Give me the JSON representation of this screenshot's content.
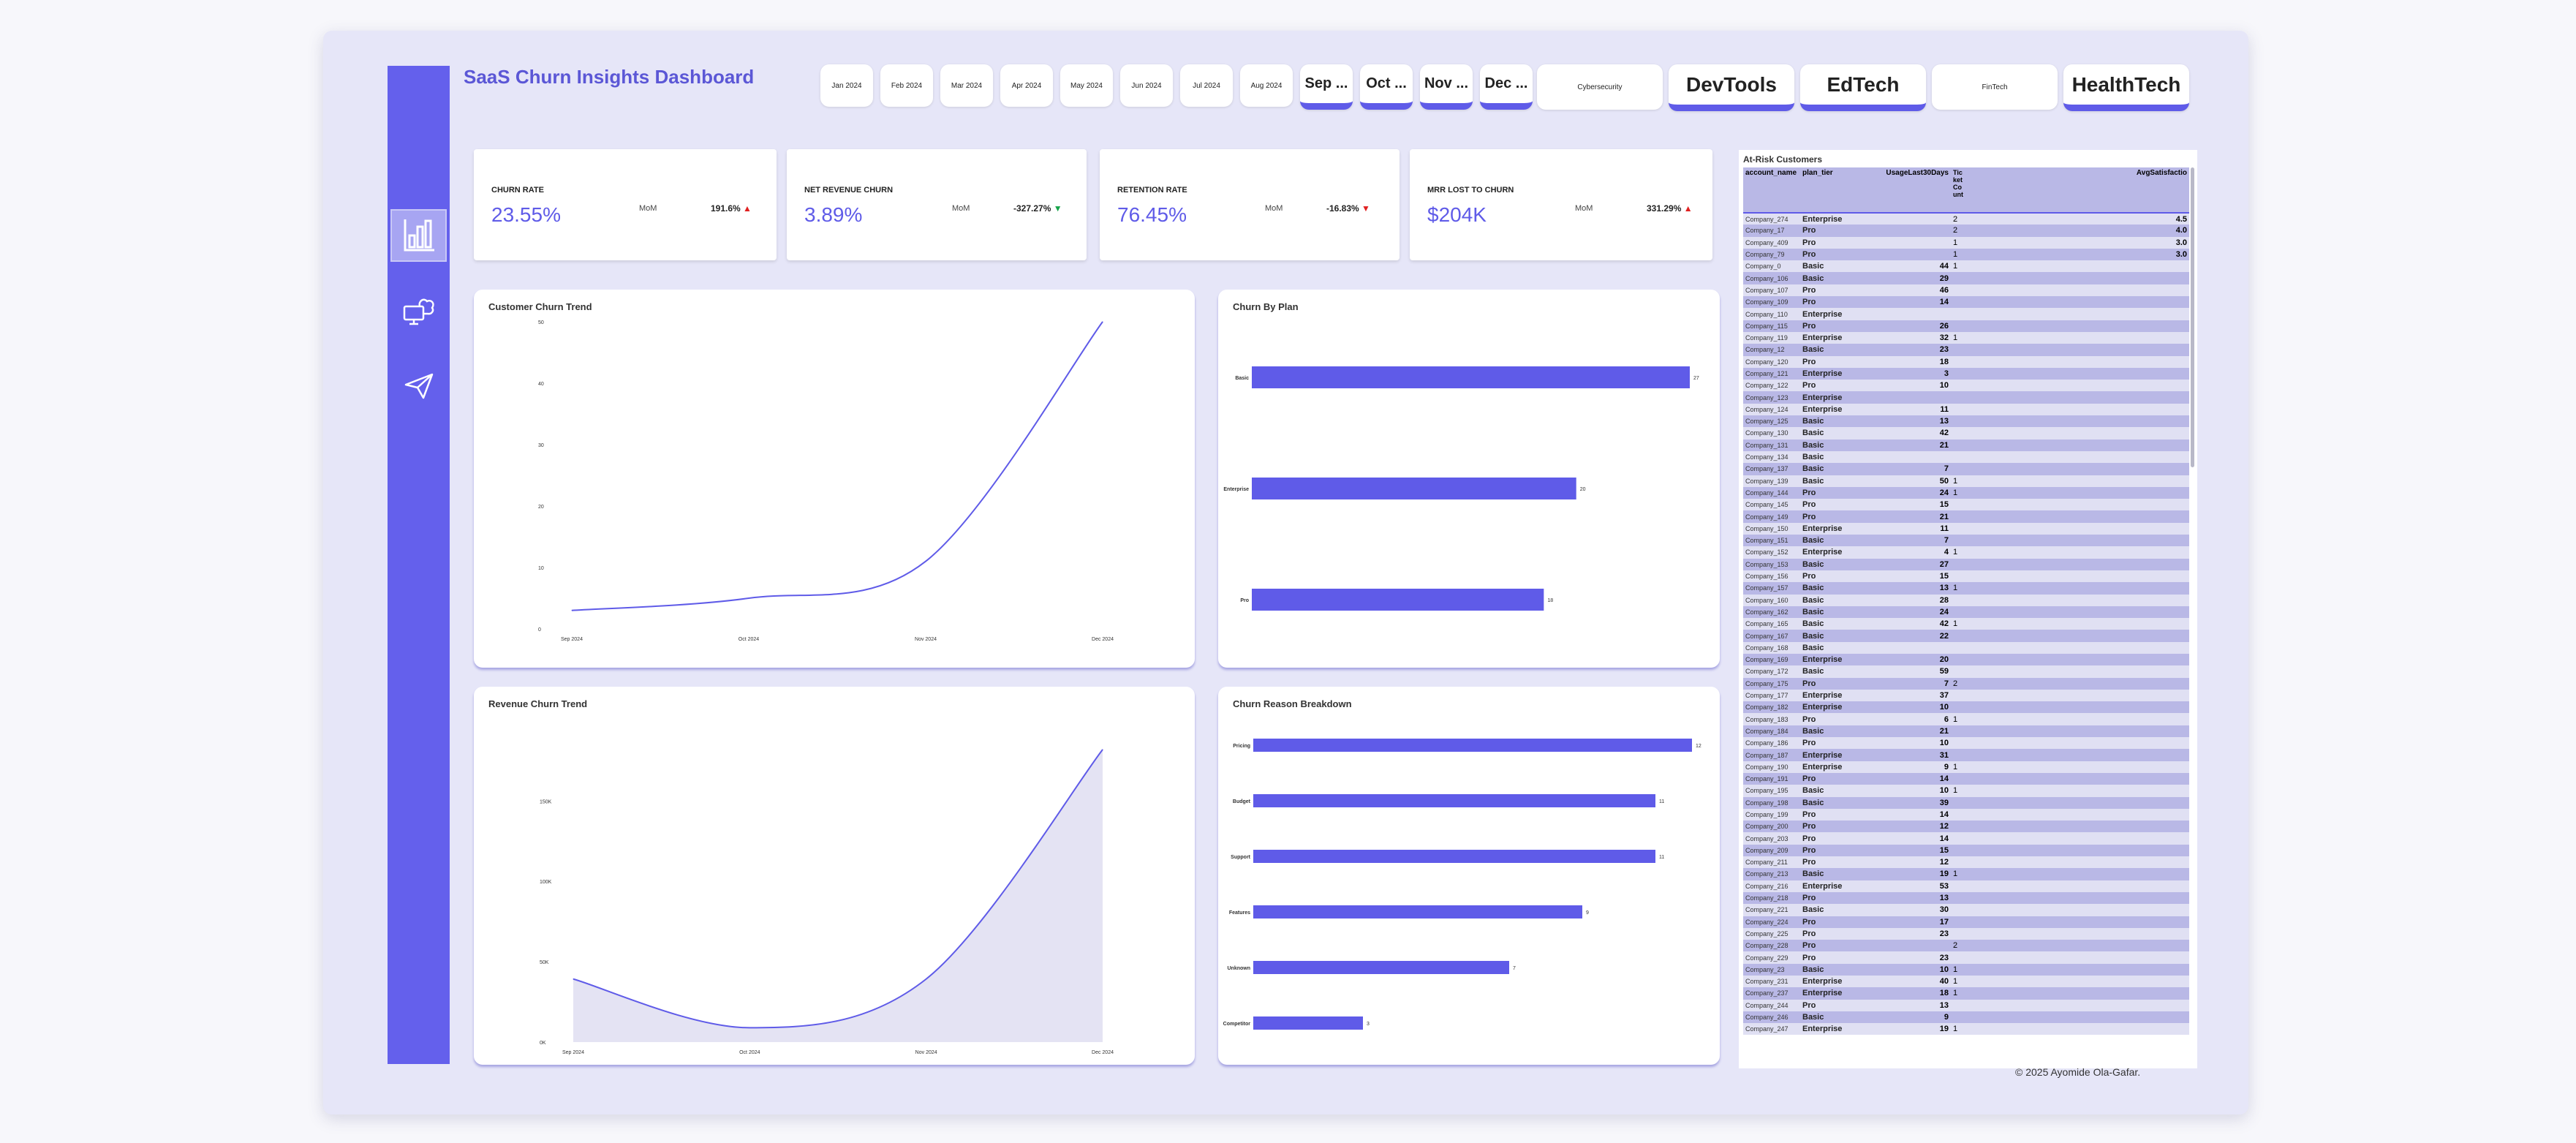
{
  "header": {
    "title": "SaaS Churn Insights Dashboard"
  },
  "months": [
    "Jan 2024",
    "Feb 2024",
    "Mar 2024",
    "Apr 2024",
    "May 2024",
    "Jun 2024",
    "Jul 2024",
    "Aug 2024",
    "Sep ...",
    "Oct ...",
    "Nov ...",
    "Dec ..."
  ],
  "industries": [
    "Cybersecurity",
    "DevTools",
    "EdTech",
    "FinTech",
    "HealthTech"
  ],
  "sidebar": {
    "icons": [
      "analytics-icon",
      "cloud-computer-icon",
      "send-icon"
    ]
  },
  "kpis": [
    {
      "title": "CHURN RATE",
      "value": "23.55%",
      "mom": "MoM",
      "change": "191.6%",
      "arrow": "▲",
      "dir": "up"
    },
    {
      "title": "NET REVENUE CHURN",
      "value": "3.89%",
      "mom": "MoM",
      "change": "-327.27%",
      "arrow": "▼",
      "dir": "down"
    },
    {
      "title": "RETENTION RATE",
      "value": "76.45%",
      "mom": "MoM",
      "change": "-16.83%",
      "arrow": "▼",
      "dir": "up"
    },
    {
      "title": "MRR LOST TO CHURN",
      "value": "$204K",
      "mom": "MoM",
      "change": "331.29%",
      "arrow": "▲",
      "dir": "up"
    }
  ],
  "colors": {
    "accent": "#5f5be8",
    "sidebar": "#6460ec",
    "background": "#e6e6f8"
  },
  "chart_data": [
    {
      "type": "line",
      "title": "Customer Churn Trend",
      "x": [
        "Sep 2024",
        "Oct 2024",
        "Nov 2024",
        "Dec 2024"
      ],
      "values": [
        3,
        5,
        11,
        50
      ],
      "ylim": [
        0,
        50
      ],
      "yticks": [
        "0",
        "10",
        "20",
        "30",
        "40",
        "50"
      ]
    },
    {
      "type": "bar",
      "title": "Churn By Plan",
      "categories": [
        "Basic",
        "Enterprise",
        "Pro"
      ],
      "values": [
        27,
        20,
        18
      ],
      "xlim": [
        0,
        27
      ]
    },
    {
      "type": "area",
      "title": "Revenue Churn Trend",
      "x": [
        "Sep 2024",
        "Oct 2024",
        "Nov 2024",
        "Dec 2024"
      ],
      "values": [
        44000,
        10000,
        44000,
        204000
      ],
      "ylim": [
        0,
        204000
      ],
      "yticks": [
        "0K",
        "50K",
        "100K",
        "150K"
      ]
    },
    {
      "type": "bar",
      "title": "Churn Reason Breakdown",
      "categories": [
        "Pricing",
        "Budget",
        "Support",
        "Features",
        "Unknown",
        "Competitor"
      ],
      "values": [
        12,
        11,
        11,
        9,
        7,
        3
      ],
      "xlim": [
        0,
        12
      ]
    }
  ],
  "table": {
    "title": "At-Risk Customers",
    "columns": [
      "account_name",
      "plan_tier",
      "UsageLast30Days",
      "Tic\nket\nCo\nunt",
      "AvgSatisfactio"
    ],
    "rows": [
      [
        "Company_274",
        "Enterprise",
        "",
        "2",
        "4.5"
      ],
      [
        "Company_17",
        "Pro",
        "",
        "2",
        "4.0"
      ],
      [
        "Company_409",
        "Pro",
        "",
        "1",
        "3.0"
      ],
      [
        "Company_79",
        "Pro",
        "",
        "1",
        "3.0"
      ],
      [
        "Company_0",
        "Basic",
        "44",
        "1",
        ""
      ],
      [
        "Company_106",
        "Basic",
        "29",
        "",
        ""
      ],
      [
        "Company_107",
        "Pro",
        "46",
        "",
        ""
      ],
      [
        "Company_109",
        "Pro",
        "14",
        "",
        ""
      ],
      [
        "Company_110",
        "Enterprise",
        "",
        "",
        ""
      ],
      [
        "Company_115",
        "Pro",
        "26",
        "",
        ""
      ],
      [
        "Company_119",
        "Enterprise",
        "32",
        "1",
        ""
      ],
      [
        "Company_12",
        "Basic",
        "23",
        "",
        ""
      ],
      [
        "Company_120",
        "Pro",
        "18",
        "",
        ""
      ],
      [
        "Company_121",
        "Enterprise",
        "3",
        "",
        ""
      ],
      [
        "Company_122",
        "Pro",
        "10",
        "",
        ""
      ],
      [
        "Company_123",
        "Enterprise",
        "",
        "",
        ""
      ],
      [
        "Company_124",
        "Enterprise",
        "11",
        "",
        ""
      ],
      [
        "Company_125",
        "Basic",
        "13",
        "",
        ""
      ],
      [
        "Company_130",
        "Basic",
        "42",
        "",
        ""
      ],
      [
        "Company_131",
        "Basic",
        "21",
        "",
        ""
      ],
      [
        "Company_134",
        "Basic",
        "",
        "",
        ""
      ],
      [
        "Company_137",
        "Basic",
        "7",
        "",
        ""
      ],
      [
        "Company_139",
        "Basic",
        "50",
        "1",
        ""
      ],
      [
        "Company_144",
        "Pro",
        "24",
        "1",
        ""
      ],
      [
        "Company_145",
        "Pro",
        "15",
        "",
        ""
      ],
      [
        "Company_149",
        "Pro",
        "21",
        "",
        ""
      ],
      [
        "Company_150",
        "Enterprise",
        "11",
        "",
        ""
      ],
      [
        "Company_151",
        "Basic",
        "7",
        "",
        ""
      ],
      [
        "Company_152",
        "Enterprise",
        "4",
        "1",
        ""
      ],
      [
        "Company_153",
        "Basic",
        "27",
        "",
        ""
      ],
      [
        "Company_156",
        "Pro",
        "15",
        "",
        ""
      ],
      [
        "Company_157",
        "Basic",
        "13",
        "1",
        ""
      ],
      [
        "Company_160",
        "Basic",
        "28",
        "",
        ""
      ],
      [
        "Company_162",
        "Basic",
        "24",
        "",
        ""
      ],
      [
        "Company_165",
        "Basic",
        "42",
        "1",
        ""
      ],
      [
        "Company_167",
        "Basic",
        "22",
        "",
        ""
      ],
      [
        "Company_168",
        "Basic",
        "",
        "",
        ""
      ],
      [
        "Company_169",
        "Enterprise",
        "20",
        "",
        ""
      ],
      [
        "Company_172",
        "Basic",
        "59",
        "",
        ""
      ],
      [
        "Company_175",
        "Pro",
        "7",
        "2",
        ""
      ],
      [
        "Company_177",
        "Enterprise",
        "37",
        "",
        ""
      ],
      [
        "Company_182",
        "Enterprise",
        "10",
        "",
        ""
      ],
      [
        "Company_183",
        "Pro",
        "6",
        "1",
        ""
      ],
      [
        "Company_184",
        "Basic",
        "21",
        "",
        ""
      ],
      [
        "Company_186",
        "Pro",
        "10",
        "",
        ""
      ],
      [
        "Company_187",
        "Enterprise",
        "31",
        "",
        ""
      ],
      [
        "Company_190",
        "Enterprise",
        "9",
        "1",
        ""
      ],
      [
        "Company_191",
        "Pro",
        "14",
        "",
        ""
      ],
      [
        "Company_195",
        "Basic",
        "10",
        "1",
        ""
      ],
      [
        "Company_198",
        "Basic",
        "39",
        "",
        ""
      ],
      [
        "Company_199",
        "Pro",
        "14",
        "",
        ""
      ],
      [
        "Company_200",
        "Pro",
        "12",
        "",
        ""
      ],
      [
        "Company_203",
        "Pro",
        "14",
        "",
        ""
      ],
      [
        "Company_209",
        "Pro",
        "15",
        "",
        ""
      ],
      [
        "Company_211",
        "Pro",
        "12",
        "",
        ""
      ],
      [
        "Company_213",
        "Basic",
        "19",
        "1",
        ""
      ],
      [
        "Company_216",
        "Enterprise",
        "53",
        "",
        ""
      ],
      [
        "Company_218",
        "Pro",
        "13",
        "",
        ""
      ],
      [
        "Company_221",
        "Basic",
        "30",
        "",
        ""
      ],
      [
        "Company_224",
        "Pro",
        "17",
        "",
        ""
      ],
      [
        "Company_225",
        "Pro",
        "23",
        "",
        ""
      ],
      [
        "Company_228",
        "Pro",
        "",
        "2",
        ""
      ],
      [
        "Company_229",
        "Pro",
        "23",
        "",
        ""
      ],
      [
        "Company_23",
        "Basic",
        "10",
        "1",
        ""
      ],
      [
        "Company_231",
        "Enterprise",
        "40",
        "1",
        ""
      ],
      [
        "Company_237",
        "Enterprise",
        "18",
        "1",
        ""
      ],
      [
        "Company_244",
        "Pro",
        "13",
        "",
        ""
      ],
      [
        "Company_246",
        "Basic",
        "9",
        "",
        ""
      ],
      [
        "Company_247",
        "Enterprise",
        "19",
        "1",
        ""
      ]
    ]
  },
  "footer": {
    "copyright": "© 2025 Ayomide Ola-Gafar."
  }
}
